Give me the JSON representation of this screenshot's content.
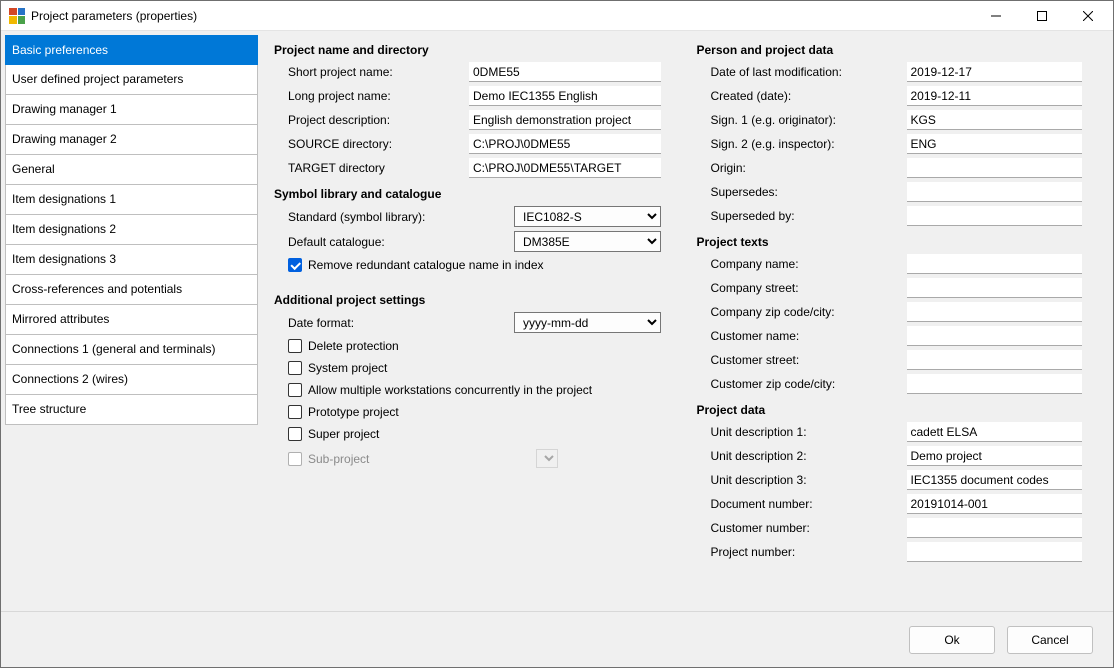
{
  "window": {
    "title": "Project parameters (properties)"
  },
  "sidebar": {
    "items": [
      "Basic preferences",
      "User defined project parameters",
      "Drawing manager 1",
      "Drawing manager 2",
      "General",
      "Item designations 1",
      "Item designations 2",
      "Item designations 3",
      "Cross-references and potentials",
      "Mirrored attributes",
      "Connections 1 (general and terminals)",
      "Connections 2 (wires)",
      "Tree structure"
    ],
    "selected_index": 0
  },
  "sections": {
    "project_name": {
      "title": "Project name and directory",
      "short_label": "Short project name:",
      "short_value": "0DME55",
      "long_label": "Long project name:",
      "long_value": "Demo IEC1355 English",
      "desc_label": "Project description:",
      "desc_value": "English demonstration project",
      "source_label": "SOURCE directory:",
      "source_value": "C:\\PROJ\\0DME55",
      "target_label": "TARGET directory",
      "target_value": "C:\\PROJ\\0DME55\\TARGET"
    },
    "symbol": {
      "title": "Symbol library and catalogue",
      "std_label": "Standard (symbol library):",
      "std_value": "IEC1082-S",
      "cat_label": "Default catalogue:",
      "cat_value": "DM385E",
      "remove_label": "Remove redundant catalogue name in index",
      "remove_checked": true
    },
    "additional": {
      "title": "Additional project settings",
      "date_label": "Date format:",
      "date_value": "yyyy-mm-dd",
      "delete_label": "Delete protection",
      "system_label": "System project",
      "multi_label": "Allow multiple workstations concurrently in the project",
      "proto_label": "Prototype project",
      "super_label": "Super project",
      "sub_label": "Sub-project"
    },
    "person": {
      "title": "Person and project data",
      "mod_label": "Date of last modification:",
      "mod_value": "2019-12-17",
      "created_label": "Created (date):",
      "created_value": "2019-12-11",
      "sign1_label": "Sign. 1 (e.g. originator):",
      "sign1_value": "KGS",
      "sign2_label": "Sign. 2 (e.g. inspector):",
      "sign2_value": "ENG",
      "origin_label": "Origin:",
      "origin_value": "",
      "supersedes_label": "Supersedes:",
      "supersedes_value": "",
      "superseded_label": "Superseded by:",
      "superseded_value": ""
    },
    "texts": {
      "title": "Project texts",
      "company_name_label": "Company name:",
      "company_name_value": "",
      "company_street_label": "Company street:",
      "company_street_value": "",
      "company_zip_label": "Company zip code/city:",
      "company_zip_value": "",
      "customer_name_label": "Customer name:",
      "customer_name_value": "",
      "customer_street_label": "Customer street:",
      "customer_street_value": "",
      "customer_zip_label": "Customer zip code/city:",
      "customer_zip_value": ""
    },
    "project_data": {
      "title": "Project data",
      "unit1_label": "Unit description 1:",
      "unit1_value": "cadett ELSA",
      "unit2_label": "Unit description 2:",
      "unit2_value": "Demo project",
      "unit3_label": "Unit description 3:",
      "unit3_value": "IEC1355 document codes",
      "docnum_label": "Document number:",
      "docnum_value": "20191014-001",
      "custnum_label": "Customer number:",
      "custnum_value": "",
      "projnum_label": "Project number:",
      "projnum_value": ""
    }
  },
  "footer": {
    "ok": "Ok",
    "cancel": "Cancel"
  }
}
